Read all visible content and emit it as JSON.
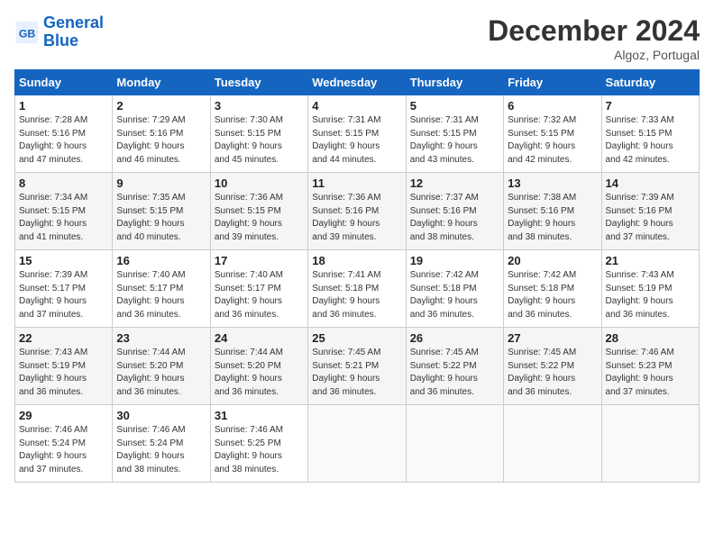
{
  "header": {
    "logo_line1": "General",
    "logo_line2": "Blue",
    "month": "December 2024",
    "location": "Algoz, Portugal"
  },
  "weekdays": [
    "Sunday",
    "Monday",
    "Tuesday",
    "Wednesday",
    "Thursday",
    "Friday",
    "Saturday"
  ],
  "weeks": [
    [
      {
        "day": "1",
        "info": "Sunrise: 7:28 AM\nSunset: 5:16 PM\nDaylight: 9 hours\nand 47 minutes."
      },
      {
        "day": "2",
        "info": "Sunrise: 7:29 AM\nSunset: 5:16 PM\nDaylight: 9 hours\nand 46 minutes."
      },
      {
        "day": "3",
        "info": "Sunrise: 7:30 AM\nSunset: 5:15 PM\nDaylight: 9 hours\nand 45 minutes."
      },
      {
        "day": "4",
        "info": "Sunrise: 7:31 AM\nSunset: 5:15 PM\nDaylight: 9 hours\nand 44 minutes."
      },
      {
        "day": "5",
        "info": "Sunrise: 7:31 AM\nSunset: 5:15 PM\nDaylight: 9 hours\nand 43 minutes."
      },
      {
        "day": "6",
        "info": "Sunrise: 7:32 AM\nSunset: 5:15 PM\nDaylight: 9 hours\nand 42 minutes."
      },
      {
        "day": "7",
        "info": "Sunrise: 7:33 AM\nSunset: 5:15 PM\nDaylight: 9 hours\nand 42 minutes."
      }
    ],
    [
      {
        "day": "8",
        "info": "Sunrise: 7:34 AM\nSunset: 5:15 PM\nDaylight: 9 hours\nand 41 minutes."
      },
      {
        "day": "9",
        "info": "Sunrise: 7:35 AM\nSunset: 5:15 PM\nDaylight: 9 hours\nand 40 minutes."
      },
      {
        "day": "10",
        "info": "Sunrise: 7:36 AM\nSunset: 5:15 PM\nDaylight: 9 hours\nand 39 minutes."
      },
      {
        "day": "11",
        "info": "Sunrise: 7:36 AM\nSunset: 5:16 PM\nDaylight: 9 hours\nand 39 minutes."
      },
      {
        "day": "12",
        "info": "Sunrise: 7:37 AM\nSunset: 5:16 PM\nDaylight: 9 hours\nand 38 minutes."
      },
      {
        "day": "13",
        "info": "Sunrise: 7:38 AM\nSunset: 5:16 PM\nDaylight: 9 hours\nand 38 minutes."
      },
      {
        "day": "14",
        "info": "Sunrise: 7:39 AM\nSunset: 5:16 PM\nDaylight: 9 hours\nand 37 minutes."
      }
    ],
    [
      {
        "day": "15",
        "info": "Sunrise: 7:39 AM\nSunset: 5:17 PM\nDaylight: 9 hours\nand 37 minutes."
      },
      {
        "day": "16",
        "info": "Sunrise: 7:40 AM\nSunset: 5:17 PM\nDaylight: 9 hours\nand 36 minutes."
      },
      {
        "day": "17",
        "info": "Sunrise: 7:40 AM\nSunset: 5:17 PM\nDaylight: 9 hours\nand 36 minutes."
      },
      {
        "day": "18",
        "info": "Sunrise: 7:41 AM\nSunset: 5:18 PM\nDaylight: 9 hours\nand 36 minutes."
      },
      {
        "day": "19",
        "info": "Sunrise: 7:42 AM\nSunset: 5:18 PM\nDaylight: 9 hours\nand 36 minutes."
      },
      {
        "day": "20",
        "info": "Sunrise: 7:42 AM\nSunset: 5:18 PM\nDaylight: 9 hours\nand 36 minutes."
      },
      {
        "day": "21",
        "info": "Sunrise: 7:43 AM\nSunset: 5:19 PM\nDaylight: 9 hours\nand 36 minutes."
      }
    ],
    [
      {
        "day": "22",
        "info": "Sunrise: 7:43 AM\nSunset: 5:19 PM\nDaylight: 9 hours\nand 36 minutes."
      },
      {
        "day": "23",
        "info": "Sunrise: 7:44 AM\nSunset: 5:20 PM\nDaylight: 9 hours\nand 36 minutes."
      },
      {
        "day": "24",
        "info": "Sunrise: 7:44 AM\nSunset: 5:20 PM\nDaylight: 9 hours\nand 36 minutes."
      },
      {
        "day": "25",
        "info": "Sunrise: 7:45 AM\nSunset: 5:21 PM\nDaylight: 9 hours\nand 36 minutes."
      },
      {
        "day": "26",
        "info": "Sunrise: 7:45 AM\nSunset: 5:22 PM\nDaylight: 9 hours\nand 36 minutes."
      },
      {
        "day": "27",
        "info": "Sunrise: 7:45 AM\nSunset: 5:22 PM\nDaylight: 9 hours\nand 36 minutes."
      },
      {
        "day": "28",
        "info": "Sunrise: 7:46 AM\nSunset: 5:23 PM\nDaylight: 9 hours\nand 37 minutes."
      }
    ],
    [
      {
        "day": "29",
        "info": "Sunrise: 7:46 AM\nSunset: 5:24 PM\nDaylight: 9 hours\nand 37 minutes."
      },
      {
        "day": "30",
        "info": "Sunrise: 7:46 AM\nSunset: 5:24 PM\nDaylight: 9 hours\nand 38 minutes."
      },
      {
        "day": "31",
        "info": "Sunrise: 7:46 AM\nSunset: 5:25 PM\nDaylight: 9 hours\nand 38 minutes."
      },
      null,
      null,
      null,
      null
    ]
  ]
}
